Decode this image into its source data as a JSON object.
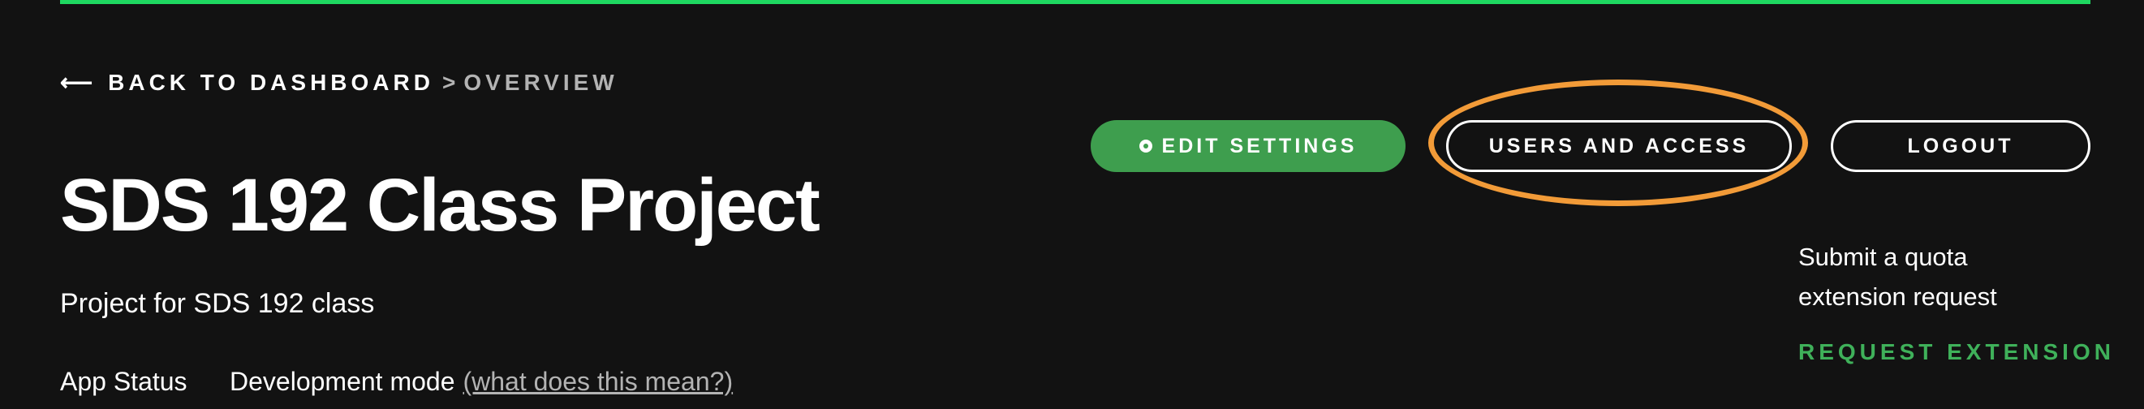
{
  "colors": {
    "background": "#121212",
    "accent_green": "#1ed760",
    "edit_button_green": "#3e9e4e",
    "highlight_orange": "#f29b38",
    "muted_text": "#b3b3b3"
  },
  "breadcrumb": {
    "back_arrow": "⟵",
    "back_label": "BACK TO DASHBOARD",
    "separator": ">",
    "current": "OVERVIEW"
  },
  "project": {
    "title": "SDS 192 Class Project",
    "description": "Project for SDS 192 class"
  },
  "status": {
    "label": "App Status",
    "value": "Development mode",
    "help_link": "(what does this mean?)"
  },
  "actions": {
    "edit_settings": "EDIT SETTINGS",
    "users_and_access": "USERS AND ACCESS",
    "logout": "LOGOUT"
  },
  "quota": {
    "text": "Submit a quota extension request",
    "link": "REQUEST EXTENSION"
  },
  "icons": {
    "back": "arrow-left-icon",
    "edit": "gear-icon"
  }
}
